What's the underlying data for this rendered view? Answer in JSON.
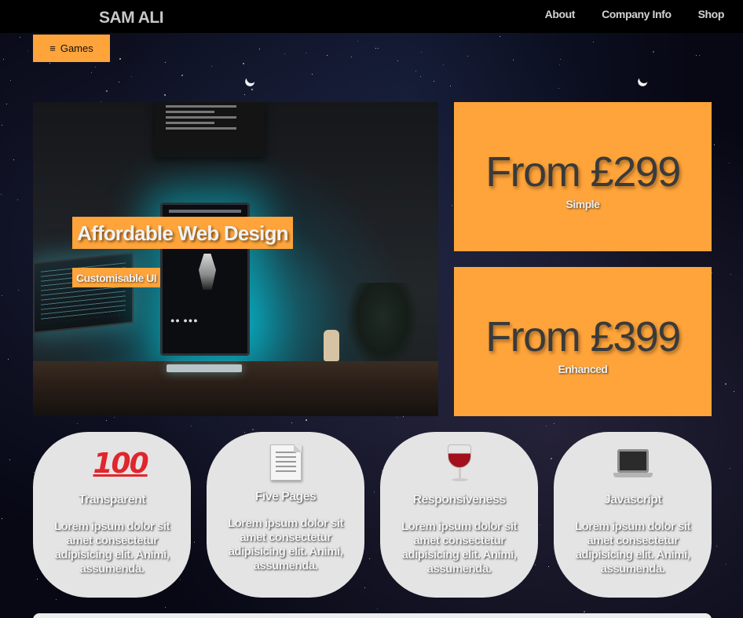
{
  "nav": {
    "brand": "SAM ALI",
    "links": [
      "About",
      "Company Info",
      "Shop"
    ],
    "games_button": "Games",
    "games_icon": "hamburger-menu-icon"
  },
  "hero": {
    "title": "Affordable Web Design",
    "subtitle": "Customisable UI",
    "accent_color": "#ffa43a"
  },
  "pricing": [
    {
      "price": "From £299",
      "tier": "Simple"
    },
    {
      "price": "From £399",
      "tier": "Enhanced"
    }
  ],
  "features": [
    {
      "icon": "hundred-points-icon",
      "icon_text": "100",
      "title": "Transparent",
      "text": "Lorem ipsum dolor sit amet consectetur adipisicing elit. Animi, assumenda."
    },
    {
      "icon": "page-icon",
      "title": "Five Pages",
      "text": "Lorem ipsum dolor sit amet consectetur adipisicing elit. Animi, assumenda."
    },
    {
      "icon": "wine-glass-icon",
      "title": "Responsiveness",
      "text": "Lorem ipsum dolor sit amet consectetur adipisicing elit. Animi, assumenda."
    },
    {
      "icon": "laptop-icon",
      "title": "Javascript",
      "text": "Lorem ipsum dolor sit amet consectetur adipisicing elit. Animi, assumenda."
    }
  ]
}
